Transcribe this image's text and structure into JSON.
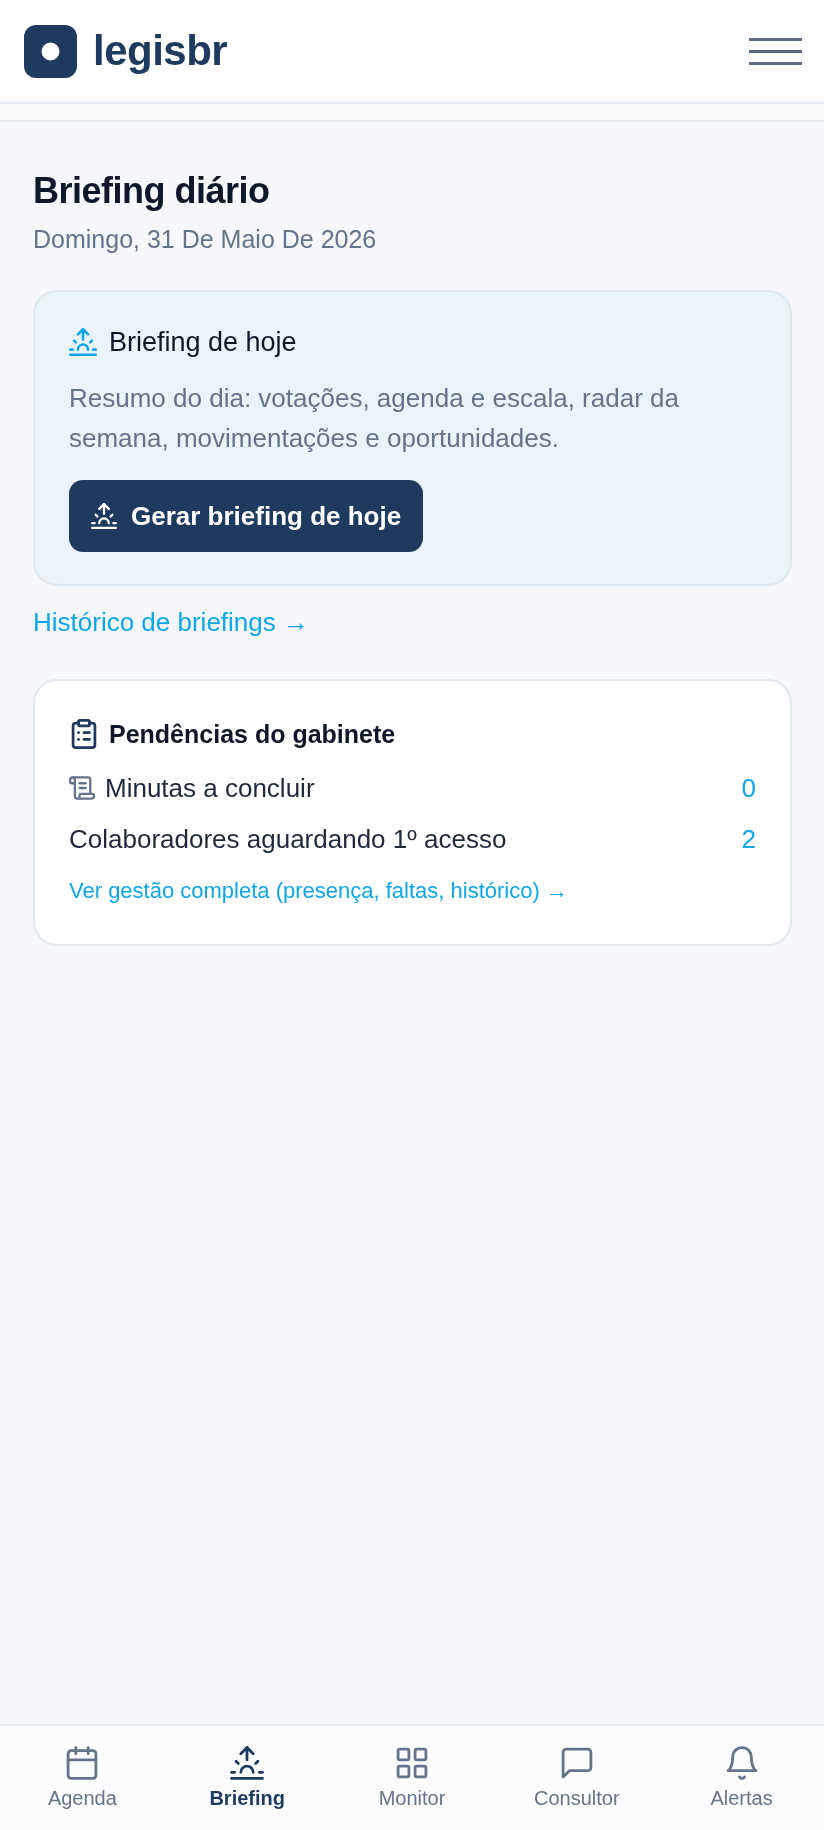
{
  "header": {
    "logo_text": "legisbr"
  },
  "page": {
    "title": "Briefing diário",
    "date": "Domingo, 31 De Maio De 2026"
  },
  "briefing_card": {
    "title": "Briefing de hoje",
    "description": "Resumo do dia: votações, agenda e escala, radar da semana, movimentações e oportunidades.",
    "button": "Gerar briefing de hoje"
  },
  "history_link": "Histórico de briefings →",
  "pending_card": {
    "title": "Pendências do gabinete",
    "rows": [
      {
        "kind": "iconed",
        "label": "Minutas a concluir",
        "value": "0"
      },
      {
        "kind": "plain",
        "label": "Colaboradores aguardando 1º acesso",
        "value": "2"
      }
    ],
    "link": "Ver gestão completa (presença, faltas, histórico) →"
  },
  "bottom_nav": [
    {
      "label": "Agenda",
      "selected": false
    },
    {
      "label": "Briefing",
      "selected": true
    },
    {
      "label": "Monitor",
      "selected": false
    },
    {
      "label": "Consultor",
      "selected": false
    },
    {
      "label": "Alertas",
      "selected": false
    }
  ]
}
